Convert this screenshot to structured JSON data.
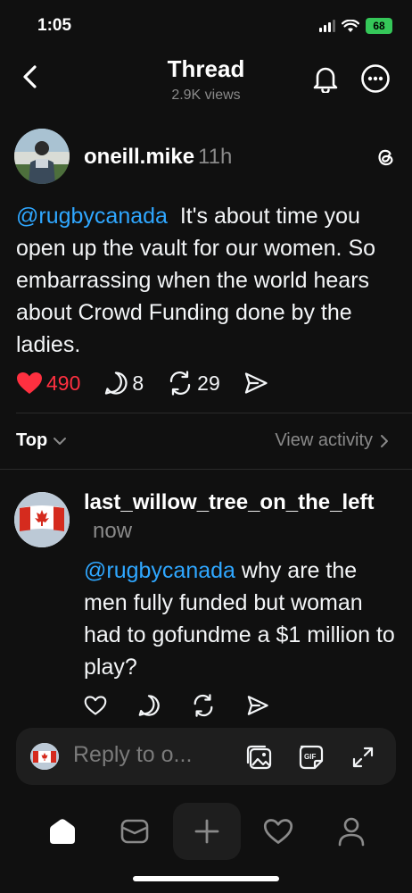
{
  "status_bar": {
    "time": "1:05",
    "battery": "68"
  },
  "header": {
    "title": "Thread",
    "views": "2.9K views"
  },
  "post": {
    "username": "oneill.mike",
    "time": "11h",
    "mention": "@rugbycanada",
    "text": "It's about time you open up the vault for our women. So embarrassing when the world hears about Crowd Funding done by the ladies.",
    "likes": "490",
    "comments": "8",
    "reposts": "29"
  },
  "sort": {
    "label": "Top",
    "view_activity": "View activity"
  },
  "reply": {
    "username": "last_willow_tree_on_the_left",
    "time": "now",
    "mention": "@rugbycanada",
    "text": "why are the men fully funded but woman had to gofundme a $1 million to play?"
  },
  "composer": {
    "placeholder": "Reply to o..."
  },
  "colors": {
    "accent_link": "#2fa7ff",
    "like_red": "#ff3040",
    "background": "#101010"
  }
}
